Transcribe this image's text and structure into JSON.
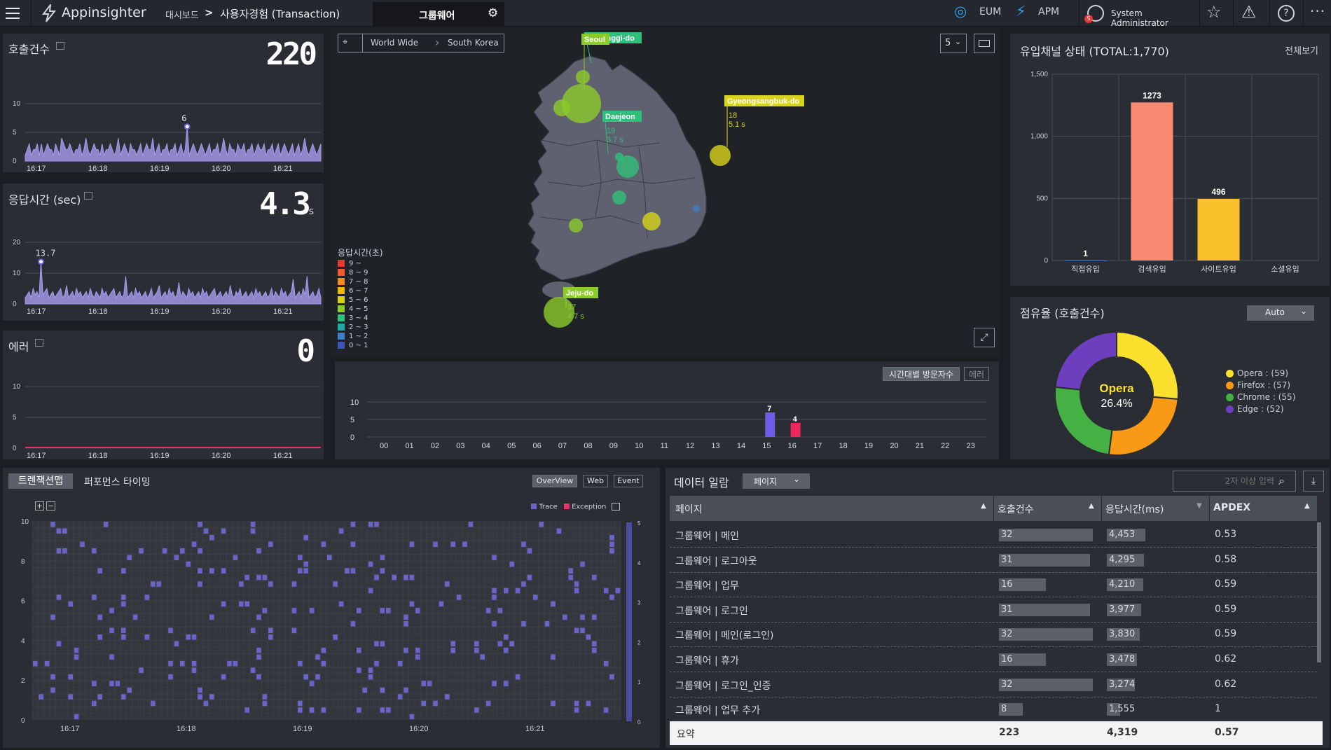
{
  "header": {
    "app_name": "Appinsighter",
    "breadcrumb_root": "대시보드",
    "breadcrumb_sep": ">",
    "breadcrumb_current": "사용자경험 (Transaction)",
    "tab_label": "그룹웨어",
    "eum_label": "EUM",
    "apm_label": "APM",
    "user_badge": "S",
    "user_name": "System Administrator"
  },
  "calls": {
    "title": "호출건수",
    "value": "220",
    "peak_label": "6",
    "y_ticks": [
      "10",
      "5",
      "0"
    ],
    "x_ticks": [
      "16:17",
      "16:18",
      "16:19",
      "16:20",
      "16:21"
    ],
    "ymax": 10,
    "series": [
      1,
      2,
      3,
      1,
      2,
      2,
      3,
      1,
      3,
      1,
      2,
      3,
      2,
      2,
      1,
      3,
      2,
      1,
      4,
      3,
      2,
      2,
      3,
      2,
      1,
      2,
      2,
      3,
      1,
      2,
      4,
      2,
      1,
      2,
      3,
      2,
      2,
      1,
      3,
      1,
      2,
      2,
      3,
      2,
      1,
      2,
      4,
      1,
      2,
      3,
      2,
      1,
      3,
      2,
      2,
      1,
      2,
      3,
      1,
      2,
      3,
      2,
      2,
      4,
      1,
      2,
      3,
      1,
      2,
      2,
      3,
      1,
      2,
      2,
      3,
      1,
      2,
      3,
      1,
      2,
      6,
      1,
      2,
      3,
      2,
      1,
      2,
      3,
      2,
      1,
      2,
      3,
      1,
      2,
      2,
      3,
      1,
      2,
      4,
      2,
      1,
      3,
      2,
      2,
      1,
      3,
      2,
      2,
      3,
      1,
      2,
      2,
      3,
      1,
      2,
      3,
      2,
      2,
      3,
      1,
      2,
      2,
      3,
      1,
      2,
      3,
      1,
      2,
      3,
      2,
      1,
      2,
      3,
      1,
      2,
      3,
      1,
      2,
      4,
      2,
      1,
      2,
      3,
      2,
      1,
      2,
      3
    ]
  },
  "response": {
    "title": "응답시간 (sec)",
    "value": "4.3",
    "unit": "s",
    "peak_label": "13.7",
    "y_ticks": [
      "20",
      "10",
      "0"
    ],
    "x_ticks": [
      "16:17",
      "16:18",
      "16:19",
      "16:20",
      "16:21"
    ],
    "ymax": 20,
    "series": [
      2,
      3,
      4,
      2,
      5,
      3,
      4,
      2,
      13.7,
      3,
      4,
      5,
      2,
      3,
      4,
      2,
      3,
      4,
      5,
      2,
      3,
      6,
      2,
      3,
      4,
      2,
      5,
      3,
      4,
      2,
      3,
      4,
      2,
      5,
      3,
      2,
      4,
      3,
      2,
      5,
      3,
      4,
      2,
      3,
      4,
      5,
      2,
      3,
      4,
      2,
      3,
      9,
      2,
      3,
      4,
      2,
      5,
      3,
      4,
      2,
      3,
      4,
      2,
      3,
      5,
      2,
      3,
      4,
      6,
      2,
      3,
      4,
      2,
      5,
      3,
      4,
      2,
      3,
      7,
      2,
      4,
      3,
      2,
      5,
      3,
      4,
      2,
      3,
      4,
      2,
      5,
      3,
      4,
      2,
      3,
      4,
      5,
      2,
      3,
      4,
      2,
      3,
      4,
      2,
      6,
      3,
      2,
      4,
      3,
      5,
      2,
      3,
      4,
      2,
      3,
      4,
      2,
      5,
      3,
      4,
      2,
      3,
      4,
      2,
      3,
      5,
      2,
      4,
      3,
      2,
      5,
      3,
      4,
      2,
      3,
      4,
      8,
      2,
      3,
      4,
      2,
      5,
      3,
      9,
      2,
      3,
      4,
      2,
      3,
      5,
      2
    ]
  },
  "errors": {
    "title": "에러",
    "value": "0",
    "y_ticks": [
      "10",
      "5",
      "0"
    ],
    "x_ticks": [
      "16:17",
      "16:18",
      "16:19",
      "16:20",
      "16:21"
    ]
  },
  "map": {
    "crumb_world": "World Wide",
    "crumb_country": "South Korea",
    "top_select": "5",
    "legend_title": "응답시간(초)",
    "legend": [
      {
        "label": "9 ~",
        "color": "#e53935"
      },
      {
        "label": "8 ~ 9",
        "color": "#ef5b2b"
      },
      {
        "label": "7 ~ 8",
        "color": "#f58a20"
      },
      {
        "label": "6 ~ 7",
        "color": "#f5b700"
      },
      {
        "label": "5 ~ 6",
        "color": "#d8d41a"
      },
      {
        "label": "4 ~ 5",
        "color": "#8ccc2a"
      },
      {
        "label": "3 ~ 4",
        "color": "#2fbf7a"
      },
      {
        "label": "2 ~ 3",
        "color": "#1fa9a3"
      },
      {
        "label": "1 ~ 2",
        "color": "#3d7fc8"
      },
      {
        "label": "0 ~ 1",
        "color": "#3f53b8"
      }
    ],
    "labels": [
      {
        "name": "Seoul",
        "calls": "",
        "time": ""
      },
      {
        "name": "Gyeonggi-do",
        "calls": "",
        "time": ""
      },
      {
        "name": "Daejeon",
        "calls": "19",
        "time": "3.7 s"
      },
      {
        "name": "Gyeongsangbuk-do",
        "calls": "18",
        "time": "5.1 s"
      },
      {
        "name": "Jeju-do",
        "calls": "37",
        "time": "4.7 s"
      }
    ]
  },
  "hourly": {
    "button_visitors": "시간대별 방문자수",
    "button_error": "에러",
    "y_ticks": [
      "10",
      "5",
      "0"
    ],
    "x_ticks": [
      "00",
      "01",
      "02",
      "03",
      "04",
      "05",
      "06",
      "07",
      "08",
      "09",
      "10",
      "11",
      "12",
      "13",
      "14",
      "15",
      "16",
      "17",
      "18",
      "19",
      "20",
      "21",
      "22",
      "23"
    ],
    "bars": [
      {
        "hour": 15,
        "value": 7,
        "label": "7",
        "color": "#6c5ce7"
      },
      {
        "hour": 16,
        "value": 4,
        "label": "4",
        "color": "#f0275a"
      }
    ]
  },
  "channel": {
    "title": "유입채널 상태 (TOTAL:1,770)",
    "view_all": "전체보기",
    "y_ticks": [
      "1,500",
      "1,000",
      "500",
      "0"
    ],
    "chart_data": {
      "type": "bar",
      "categories": [
        "직접유입",
        "검색유입",
        "사이트유입",
        "소셜유입"
      ],
      "values": [
        1,
        1273,
        496,
        0
      ],
      "labels": [
        "1",
        "1273",
        "496",
        ""
      ],
      "colors": [
        "#4a78c8",
        "#f88b72",
        "#fbc12c",
        "#888"
      ],
      "ylim": [
        0,
        1500
      ]
    }
  },
  "share": {
    "title": "점유율 (호출건수)",
    "select": "Auto",
    "center_name": "Opera",
    "center_value": "26.4%",
    "chart_data": {
      "type": "pie",
      "slices": [
        {
          "name": "Opera",
          "value": 59,
          "label": "Opera : (59)",
          "color": "#fbe02e"
        },
        {
          "name": "Firefox",
          "value": 57,
          "label": "Firefox : (57)",
          "color": "#f99a16"
        },
        {
          "name": "Chrome",
          "value": 55,
          "label": "Chrome : (55)",
          "color": "#45b043"
        },
        {
          "name": "Edge",
          "value": 52,
          "label": "Edge : (52)",
          "color": "#6d3fbf"
        }
      ]
    }
  },
  "txmap": {
    "tab_active": "트렌잭션맵",
    "tab_other": "퍼포먼스 타이밍",
    "btn_overview": "OverView",
    "btn_web": "Web",
    "btn_event": "Event",
    "legend_trace": "Trace",
    "legend_exception": "Exception",
    "y_ticks": [
      "10",
      "8",
      "6",
      "4",
      "2",
      "0"
    ],
    "x_ticks": [
      "16:17",
      "16:18",
      "16:19",
      "16:20",
      "16:21"
    ],
    "right_ticks": [
      "5",
      "4",
      "3",
      "2",
      "1",
      "0"
    ]
  },
  "datalist": {
    "title": "데이터 일람",
    "select": "페이지",
    "search_placeholder": "2자 이상 입력",
    "columns": [
      "페이지",
      "호출건수",
      "응답시간(ms)",
      "APDEX"
    ],
    "rows": [
      {
        "page": "그룹웨어 | 메인",
        "calls": "32",
        "time": "4,453",
        "apdex": "0.53",
        "cf": 1.0,
        "tf": 0.55
      },
      {
        "page": "그룹웨어 | 로그아웃",
        "calls": "31",
        "time": "4,295",
        "apdex": "0.58",
        "cf": 0.97,
        "tf": 0.53
      },
      {
        "page": "그룹웨어 | 업무",
        "calls": "16",
        "time": "4,210",
        "apdex": "0.59",
        "cf": 0.5,
        "tf": 0.52
      },
      {
        "page": "그룹웨어 | 로그인",
        "calls": "31",
        "time": "3,977",
        "apdex": "0.59",
        "cf": 0.97,
        "tf": 0.49
      },
      {
        "page": "그룹웨어 | 메인(로그인)",
        "calls": "32",
        "time": "3,830",
        "apdex": "0.59",
        "cf": 1.0,
        "tf": 0.47
      },
      {
        "page": "그룹웨어 | 휴가",
        "calls": "16",
        "time": "3,478",
        "apdex": "0.62",
        "cf": 0.5,
        "tf": 0.43
      },
      {
        "page": "그룹웨어 | 로그인_인증",
        "calls": "32",
        "time": "3,274",
        "apdex": "0.62",
        "cf": 1.0,
        "tf": 0.4
      },
      {
        "page": "그룹웨어 | 업무 추가",
        "calls": "8",
        "time": "1,555",
        "apdex": "1",
        "cf": 0.25,
        "tf": 0.19
      }
    ],
    "summary": {
      "label": "요약",
      "calls": "223",
      "time": "4,319",
      "apdex": "0.57"
    }
  }
}
